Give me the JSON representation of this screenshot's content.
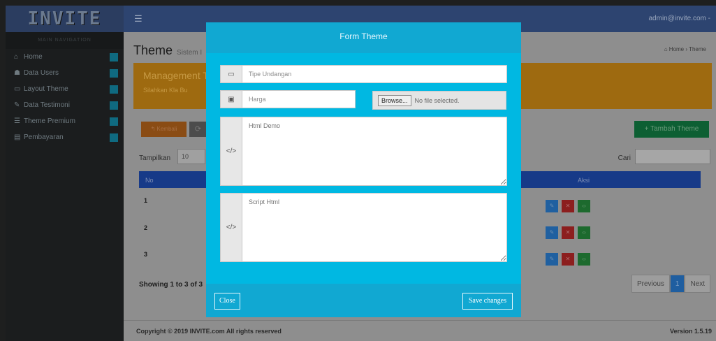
{
  "header": {
    "logo": "INVITE",
    "menu_icon": "☰",
    "user": "admin@invite.com -"
  },
  "sidebar": {
    "heading": "MAIN NAVIGATION",
    "items": [
      {
        "icon": "home-icon",
        "glyph": "⌂",
        "label": "Home"
      },
      {
        "icon": "users-icon",
        "glyph": "👥",
        "label": "Data Users"
      },
      {
        "icon": "monitor-icon",
        "glyph": "▭",
        "label": "Layout Theme"
      },
      {
        "icon": "edit-icon",
        "glyph": "✎",
        "label": "Data Testimoni"
      },
      {
        "icon": "list-icon",
        "glyph": "☰",
        "label": "Theme Premium"
      },
      {
        "icon": "document-icon",
        "glyph": "▤",
        "label": "Pembayaran"
      }
    ]
  },
  "content": {
    "title": "Theme",
    "subtitle": "Sistem I",
    "breadcrumb": "⌂ Home › Theme",
    "alert_title": "Management T",
    "alert_text": "Silahkan Kla Bu",
    "btn_kembali": "↰ Kembali",
    "btn_refresh": "⟳",
    "btn_tambah": "+ Tambah Theme",
    "show_label": "Tampilkan",
    "show_value": "10",
    "search_label": "Cari",
    "col_no": "No",
    "col_aksi": "Aksi",
    "rows": [
      "1",
      "2",
      "3"
    ],
    "showing": "Showing 1 to 3 of 3",
    "pager": {
      "prev": "Previous",
      "current": "1",
      "next": "Next"
    },
    "footer_copy": "Copyright © 2019 INVITE.com All rights reserved",
    "footer_version": "Version 1.5.19"
  },
  "modal": {
    "title": "Form Theme",
    "tipe_placeholder": "Tipe Undangan",
    "harga_placeholder": "Harga",
    "browse_label": "Browse...",
    "file_status": "No file selected.",
    "html_demo_placeholder": "Html Demo",
    "script_html_placeholder": "Script Html",
    "close_label": "Close",
    "save_label": "Save changes"
  }
}
